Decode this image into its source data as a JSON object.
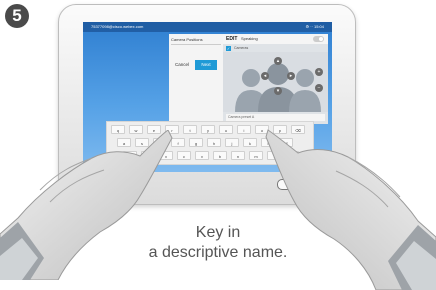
{
  "step_badge": "5",
  "screen": {
    "status_left": "75377098@cisco.webex.com",
    "status_right": "⚙ ·· 15:04",
    "edit_panel": {
      "title": "Camera Positions",
      "cancel_label": "Cancel",
      "next_label": "Next"
    },
    "camera_panel": {
      "icon_text": "EDIT",
      "title": "Speaking",
      "checkbox_label": "Cameras",
      "name_field": "Camera preset A"
    }
  },
  "keyboard": {
    "rows": [
      [
        "q",
        "w",
        "e",
        "r",
        "t",
        "y",
        "u",
        "i",
        "o",
        "p",
        "⌫"
      ],
      [
        "a",
        "s",
        "d",
        "f",
        "g",
        "h",
        "j",
        "k",
        "l",
        "⏎"
      ],
      [
        "⇧",
        "z",
        "x",
        "c",
        "v",
        "b",
        "n",
        "m",
        ",",
        "."
      ]
    ]
  },
  "caption": {
    "line1": "Key in",
    "line2": "a descriptive name."
  },
  "colors": {
    "screen_top": "#2f7fd1",
    "screen_bottom": "#7fbaef",
    "next_button": "#1f9ad6",
    "badge": "#4a4a4a"
  }
}
